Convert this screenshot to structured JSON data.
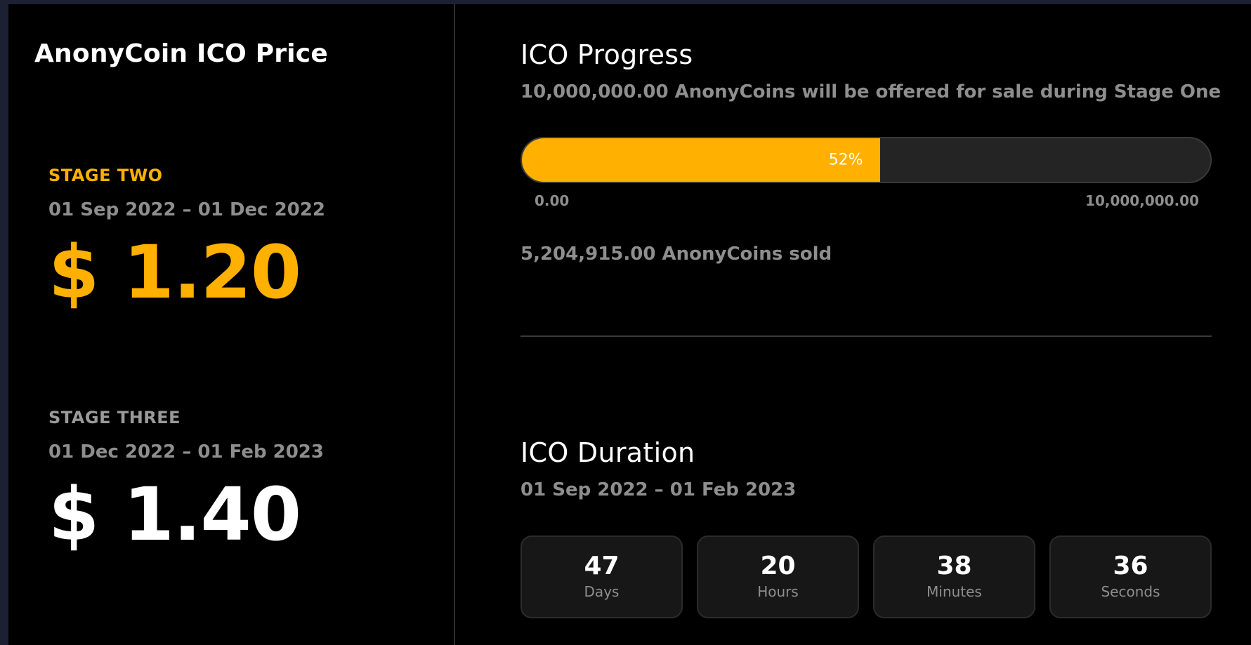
{
  "colors": {
    "accent": "#ffb000",
    "muted": "#8e8e8e",
    "active_price": "#ffb000",
    "inactive_price": "#ffffff",
    "inactive_label": "#9a9a9a"
  },
  "price_panel": {
    "title": "AnonyCoin ICO Price",
    "stages": [
      {
        "label": "STAGE TWO",
        "dates": "01 Sep 2022 – 01 Dec 2022",
        "price": "$ 1.20",
        "active": true
      },
      {
        "label": "STAGE THREE",
        "dates": "01 Dec 2022 – 01 Feb 2023",
        "price": "$ 1.40",
        "active": false
      }
    ]
  },
  "progress": {
    "title": "ICO Progress",
    "subtitle": "10,000,000.00 AnonyCoins will be offered for sale during Stage One",
    "percent_label": "52%",
    "fraction": 0.52,
    "min_label": "0.00",
    "max_label": "10,000,000.00",
    "sold_text": "5,204,915.00 AnonyCoins sold"
  },
  "duration": {
    "title": "ICO Duration",
    "dates": "01 Sep 2022 – 01 Feb 2023",
    "countdown": [
      {
        "value": "47",
        "unit": "Days"
      },
      {
        "value": "20",
        "unit": "Hours"
      },
      {
        "value": "38",
        "unit": "Minutes"
      },
      {
        "value": "36",
        "unit": "Seconds"
      }
    ]
  }
}
